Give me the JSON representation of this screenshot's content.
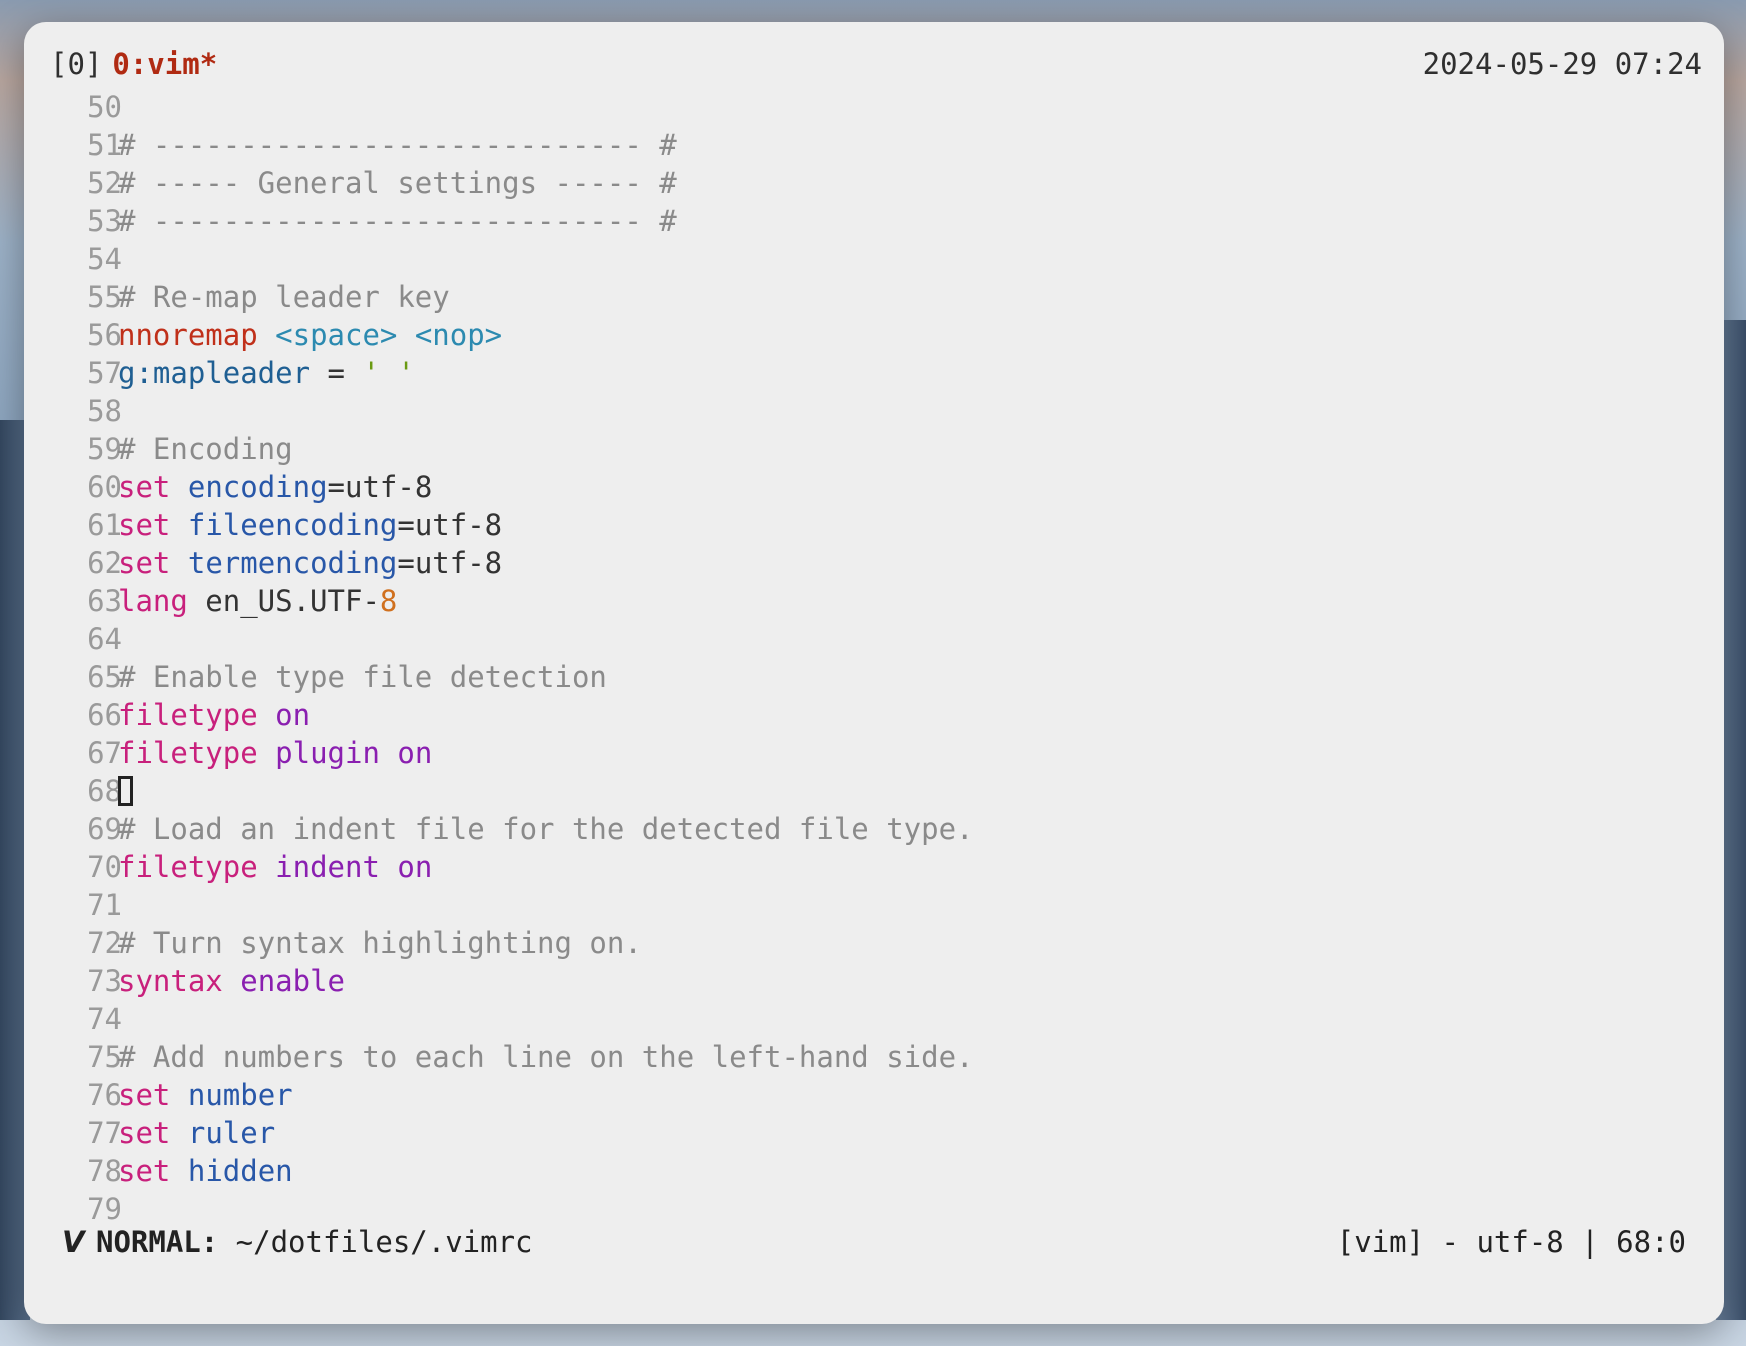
{
  "tmux": {
    "session": "[0]",
    "window": "0:vim*",
    "clock": "2024-05-29 07:24"
  },
  "editor": {
    "lines": [
      {
        "n": "50",
        "tokens": []
      },
      {
        "n": "51",
        "tokens": [
          {
            "c": "comment",
            "t": "# ---------------------------- #"
          }
        ]
      },
      {
        "n": "52",
        "tokens": [
          {
            "c": "comment",
            "t": "# ----- General settings ----- #"
          }
        ]
      },
      {
        "n": "53",
        "tokens": [
          {
            "c": "comment",
            "t": "# ---------------------------- #"
          }
        ]
      },
      {
        "n": "54",
        "tokens": []
      },
      {
        "n": "55",
        "tokens": [
          {
            "c": "comment",
            "t": "# Re-map leader key"
          }
        ]
      },
      {
        "n": "56",
        "tokens": [
          {
            "c": "red",
            "t": "nnoremap"
          },
          {
            "c": "plain",
            "t": " "
          },
          {
            "c": "bracket",
            "t": "<space>"
          },
          {
            "c": "plain",
            "t": " "
          },
          {
            "c": "bracket",
            "t": "<nop>"
          }
        ]
      },
      {
        "n": "57",
        "tokens": [
          {
            "c": "var",
            "t": "g:mapleader"
          },
          {
            "c": "plain",
            "t": " = "
          },
          {
            "c": "string",
            "t": "' '"
          }
        ]
      },
      {
        "n": "58",
        "tokens": []
      },
      {
        "n": "59",
        "tokens": [
          {
            "c": "comment",
            "t": "# Encoding"
          }
        ]
      },
      {
        "n": "60",
        "tokens": [
          {
            "c": "keyword",
            "t": "set"
          },
          {
            "c": "plain",
            "t": " "
          },
          {
            "c": "option",
            "t": "encoding"
          },
          {
            "c": "plain",
            "t": "=utf-8"
          }
        ]
      },
      {
        "n": "61",
        "tokens": [
          {
            "c": "keyword",
            "t": "set"
          },
          {
            "c": "plain",
            "t": " "
          },
          {
            "c": "option",
            "t": "fileencoding"
          },
          {
            "c": "plain",
            "t": "=utf-8"
          }
        ]
      },
      {
        "n": "62",
        "tokens": [
          {
            "c": "keyword",
            "t": "set"
          },
          {
            "c": "plain",
            "t": " "
          },
          {
            "c": "option",
            "t": "termencoding"
          },
          {
            "c": "plain",
            "t": "=utf-8"
          }
        ]
      },
      {
        "n": "63",
        "tokens": [
          {
            "c": "keyword",
            "t": "lang"
          },
          {
            "c": "plain",
            "t": " en_US.UTF-"
          },
          {
            "c": "number",
            "t": "8"
          }
        ]
      },
      {
        "n": "64",
        "tokens": []
      },
      {
        "n": "65",
        "tokens": [
          {
            "c": "comment",
            "t": "# Enable type file detection"
          }
        ]
      },
      {
        "n": "66",
        "tokens": [
          {
            "c": "keyword",
            "t": "filetype"
          },
          {
            "c": "plain",
            "t": " "
          },
          {
            "c": "value",
            "t": "on"
          }
        ]
      },
      {
        "n": "67",
        "tokens": [
          {
            "c": "keyword",
            "t": "filetype"
          },
          {
            "c": "plain",
            "t": " "
          },
          {
            "c": "value",
            "t": "plugin"
          },
          {
            "c": "plain",
            "t": " "
          },
          {
            "c": "value",
            "t": "on"
          }
        ]
      },
      {
        "n": "68",
        "tokens": [],
        "cursor": true
      },
      {
        "n": "69",
        "tokens": [
          {
            "c": "comment",
            "t": "# Load an indent file for the detected file type."
          }
        ]
      },
      {
        "n": "70",
        "tokens": [
          {
            "c": "keyword",
            "t": "filetype"
          },
          {
            "c": "plain",
            "t": " "
          },
          {
            "c": "value",
            "t": "indent"
          },
          {
            "c": "plain",
            "t": " "
          },
          {
            "c": "value",
            "t": "on"
          }
        ]
      },
      {
        "n": "71",
        "tokens": []
      },
      {
        "n": "72",
        "tokens": [
          {
            "c": "comment",
            "t": "# Turn syntax highlighting on."
          }
        ]
      },
      {
        "n": "73",
        "tokens": [
          {
            "c": "keyword",
            "t": "syntax"
          },
          {
            "c": "plain",
            "t": " "
          },
          {
            "c": "value",
            "t": "enable"
          }
        ]
      },
      {
        "n": "74",
        "tokens": []
      },
      {
        "n": "75",
        "tokens": [
          {
            "c": "comment",
            "t": "# Add numbers to each line on the left-hand side."
          }
        ]
      },
      {
        "n": "76",
        "tokens": [
          {
            "c": "keyword",
            "t": "set"
          },
          {
            "c": "plain",
            "t": " "
          },
          {
            "c": "option",
            "t": "number"
          }
        ]
      },
      {
        "n": "77",
        "tokens": [
          {
            "c": "keyword",
            "t": "set"
          },
          {
            "c": "plain",
            "t": " "
          },
          {
            "c": "option",
            "t": "ruler"
          }
        ]
      },
      {
        "n": "78",
        "tokens": [
          {
            "c": "keyword",
            "t": "set"
          },
          {
            "c": "plain",
            "t": " "
          },
          {
            "c": "option",
            "t": "hidden"
          }
        ]
      },
      {
        "n": "79",
        "tokens": []
      }
    ]
  },
  "statusline": {
    "icon": "vim-logo-icon",
    "mode": "NORMAL:",
    "path": " ~/dotfiles/.vimrc",
    "right": "[vim] - utf-8 | 68:0"
  }
}
